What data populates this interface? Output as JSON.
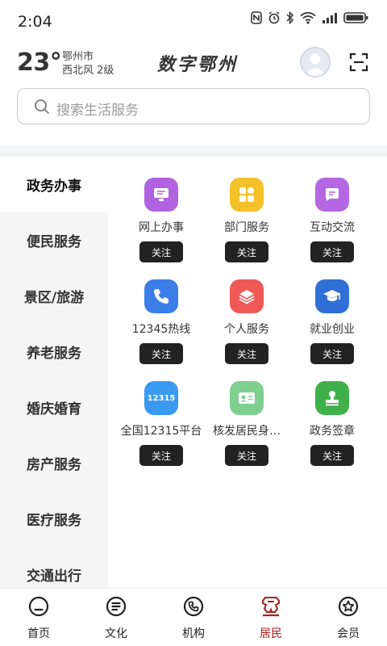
{
  "status_bar": {
    "time": "2:04"
  },
  "header": {
    "temperature": "23°",
    "city": "鄂州市",
    "wind": "西北风  2级",
    "logo_text": "数字鄂州"
  },
  "search": {
    "placeholder": "搜索生活服务"
  },
  "sidebar": {
    "items": [
      {
        "label": "政务办事",
        "active": true
      },
      {
        "label": "便民服务",
        "active": false
      },
      {
        "label": "景区/旅游",
        "active": false
      },
      {
        "label": "养老服务",
        "active": false
      },
      {
        "label": "婚庆婚育",
        "active": false
      },
      {
        "label": "房产服务",
        "active": false
      },
      {
        "label": "医疗服务",
        "active": false
      },
      {
        "label": "交通出行",
        "active": false
      }
    ]
  },
  "services": {
    "follow_label": "关注",
    "items": [
      {
        "label": "网上办事",
        "icon": "monitor-icon",
        "color": "#b062e0"
      },
      {
        "label": "部门服务",
        "icon": "grid-apps-icon",
        "color": "#f5c12a"
      },
      {
        "label": "互动交流",
        "icon": "chat-icon",
        "color": "#b467e2"
      },
      {
        "label": "12345热线",
        "icon": "phone-icon",
        "color": "#3c7ee8"
      },
      {
        "label": "个人服务",
        "icon": "layers-icon",
        "color": "#ef5a57"
      },
      {
        "label": "就业创业",
        "icon": "graduation-cap-icon",
        "color": "#2f6fd6"
      },
      {
        "label": "全国12315平台",
        "icon": "badge-12315-icon",
        "color": "#3a9af0",
        "badge_text": "12315"
      },
      {
        "label": "核发居民身…",
        "icon": "id-card-icon",
        "color": "#7fcf8f"
      },
      {
        "label": "政务签章",
        "icon": "stamp-icon",
        "color": "#3fb04a"
      }
    ]
  },
  "tabbar": {
    "items": [
      {
        "label": "首页",
        "icon": "home-icon",
        "active": false
      },
      {
        "label": "文化",
        "icon": "document-icon",
        "active": false
      },
      {
        "label": "机构",
        "icon": "phone-circle-icon",
        "active": false
      },
      {
        "label": "居民",
        "icon": "residents-icon",
        "active": true
      },
      {
        "label": "会员",
        "icon": "member-star-icon",
        "active": false
      }
    ]
  }
}
